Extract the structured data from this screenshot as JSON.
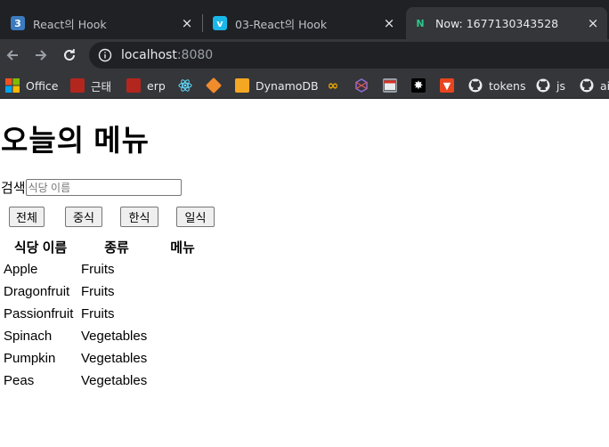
{
  "browser": {
    "tabs": [
      {
        "title": "React의 Hook",
        "favicon": "number-3-icon",
        "favicon_color": "#3b7bbf",
        "favicon_text": "3"
      },
      {
        "title": "03-React의 Hook",
        "favicon": "vimeo-icon",
        "favicon_color": "#1ab7ea",
        "favicon_text": "v"
      },
      {
        "title": "Now: 1677130343528",
        "favicon": "next-icon",
        "favicon_color": "#27c98c",
        "favicon_text": "N"
      }
    ],
    "url": {
      "host": "localhost",
      "port": ":8080"
    },
    "bookmarks": [
      {
        "label": "Office",
        "icon": "office-icon"
      },
      {
        "label": "근태",
        "icon": "doc-icon"
      },
      {
        "label": "erp",
        "icon": "doc-icon"
      },
      {
        "label": "",
        "icon": "react-icon"
      },
      {
        "label": "",
        "icon": "box-icon"
      },
      {
        "label": "DynamoDB",
        "icon": "dynamodb-icon"
      },
      {
        "label": "",
        "icon": "infinity-icon"
      },
      {
        "label": "",
        "icon": "cube-icon"
      },
      {
        "label": "",
        "icon": "window-icon"
      },
      {
        "label": "",
        "icon": "star-icon"
      },
      {
        "label": "",
        "icon": "gitlab-icon"
      },
      {
        "label": "tokens",
        "icon": "github-icon"
      },
      {
        "label": "js",
        "icon": "github-icon"
      },
      {
        "label": "ai",
        "icon": "github-icon"
      }
    ]
  },
  "page": {
    "title": "오늘의 메뉴",
    "search": {
      "label": "검색",
      "placeholder": "식당 이름",
      "value": ""
    },
    "filters": [
      "전체",
      "중식",
      "한식",
      "일식"
    ],
    "table": {
      "headers": [
        "식당 이름",
        "종류",
        "메뉴"
      ],
      "rows": [
        [
          "Apple",
          "Fruits",
          ""
        ],
        [
          "Dragonfruit",
          "Fruits",
          ""
        ],
        [
          "Passionfruit",
          "Fruits",
          ""
        ],
        [
          "Spinach",
          "Vegetables",
          ""
        ],
        [
          "Pumpkin",
          "Vegetables",
          ""
        ],
        [
          "Peas",
          "Vegetables",
          ""
        ]
      ]
    }
  }
}
